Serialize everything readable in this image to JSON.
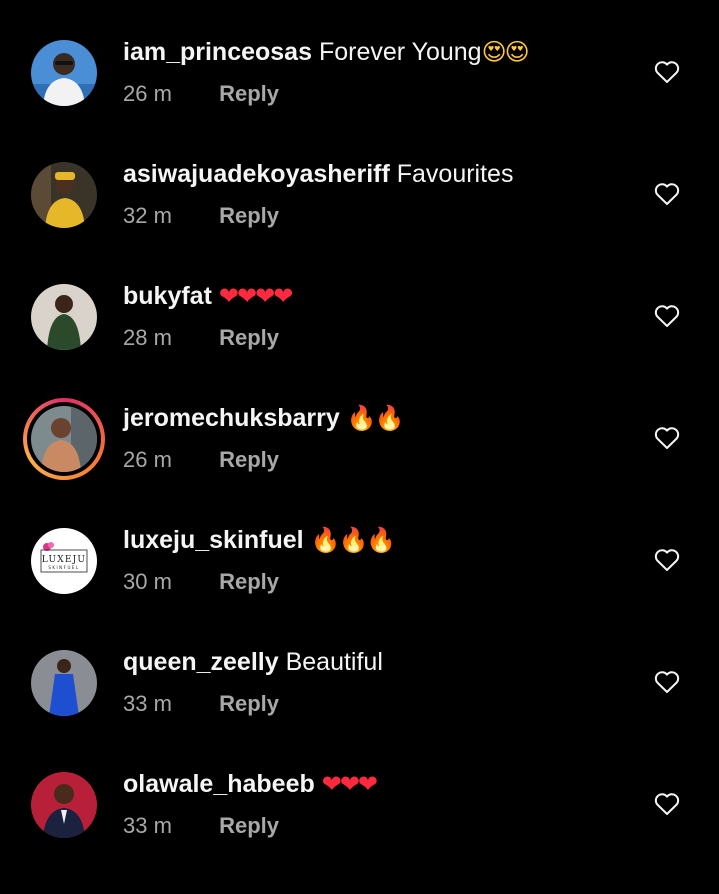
{
  "comments": [
    {
      "username": "iam_princeosas",
      "text": "Forever Young",
      "emoji": "😍😍",
      "emoji_kind": "face",
      "time": "26 m",
      "reply": "Reply",
      "avatar_bg": "#4a8fd6",
      "avatar_fg": "#f2f2f2"
    },
    {
      "username": "asiwajuadekoyasheriff",
      "text": "Favourites",
      "emoji": "",
      "emoji_kind": "",
      "time": "32 m",
      "reply": "Reply",
      "avatar_bg": "#3a3328",
      "avatar_fg": "#e7b72a"
    },
    {
      "username": "bukyfat",
      "text": "",
      "emoji": "❤❤❤❤",
      "emoji_kind": "heart",
      "time": "28 m",
      "reply": "Reply",
      "avatar_bg": "#d9d3cc",
      "avatar_fg": "#2b4a2b"
    },
    {
      "username": "jeromechuksbarry",
      "text": "",
      "emoji": "🔥🔥",
      "emoji_kind": "fire",
      "time": "26 m",
      "reply": "Reply",
      "avatar_bg": "#7d8a8e",
      "avatar_fg": "#c98a63"
    },
    {
      "username": "luxeju_skinfuel",
      "text": "",
      "emoji": "🔥🔥🔥",
      "emoji_kind": "fire",
      "time": "30 m",
      "reply": "Reply",
      "avatar_bg": "#ffffff",
      "avatar_fg": "#222222",
      "logo_text": "LUXEJU",
      "logo_sub": "SKINFUEL"
    },
    {
      "username": "queen_zeelly",
      "text": "Beautiful",
      "emoji": "",
      "emoji_kind": "",
      "time": "33 m",
      "reply": "Reply",
      "avatar_bg": "#8a8d93",
      "avatar_fg": "#1f4fd1"
    },
    {
      "username": "olawale_habeeb",
      "text": "",
      "emoji": "❤❤❤",
      "emoji_kind": "heart",
      "time": "33 m",
      "reply": "Reply",
      "avatar_bg": "#b8203a",
      "avatar_fg": "#1a2240"
    }
  ],
  "icons": {
    "like": "heart-outline-icon"
  },
  "colors": {
    "background": "#000000",
    "text": "#f5f5f5",
    "muted": "#a8a8a8"
  }
}
